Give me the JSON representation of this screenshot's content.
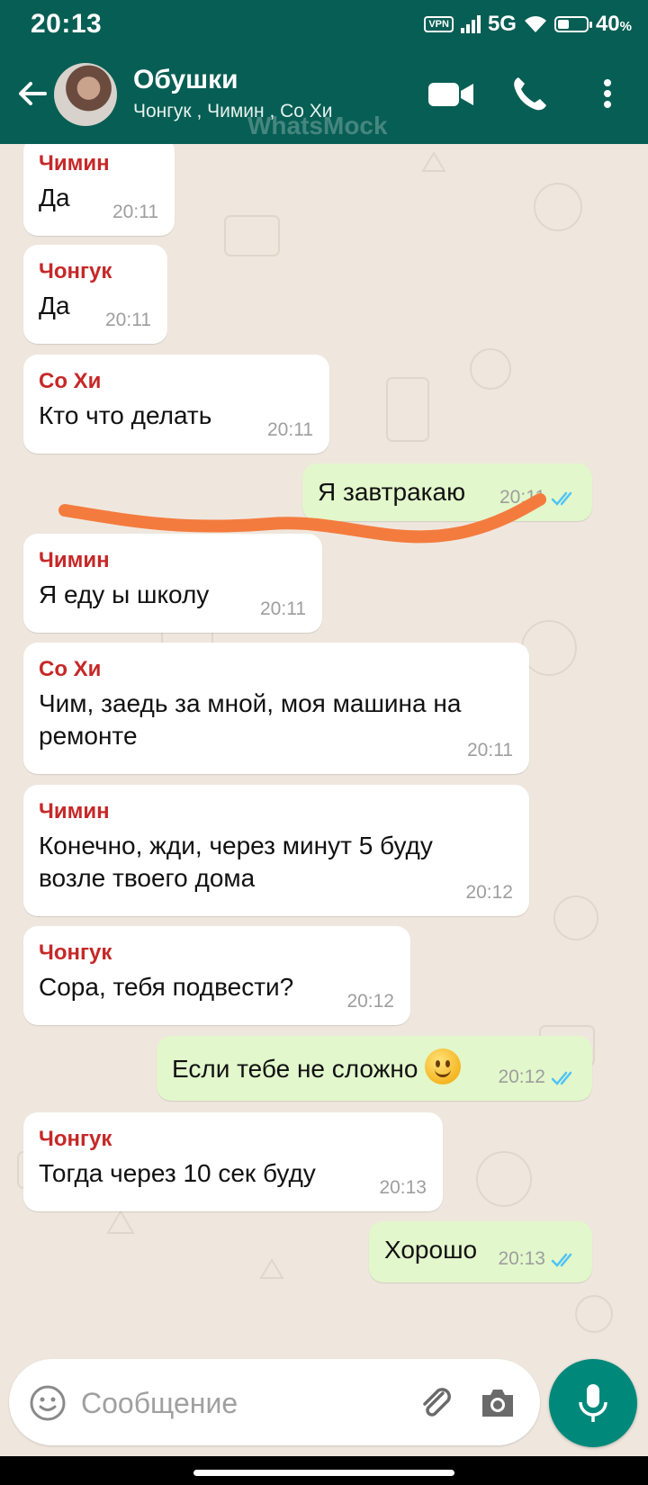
{
  "status_bar": {
    "time": "20:13",
    "vpn": "VPN",
    "network": "5G",
    "battery": "40",
    "battery_level": 0.4
  },
  "header": {
    "title": "Обушки",
    "members": "Чонгук , Чимин , Со Хи",
    "watermark": "WhatsMock"
  },
  "messages": [
    {
      "direction": "in",
      "sender": "Чимин",
      "lines": [
        "Да"
      ],
      "time": "20:11"
    },
    {
      "direction": "in",
      "sender": "Чонгук",
      "lines": [
        "Да"
      ],
      "time": "20:11"
    },
    {
      "direction": "in",
      "sender": "Со Хи",
      "lines": [
        "Кто что делать"
      ],
      "time": "20:11"
    },
    {
      "direction": "out",
      "lines": [
        "Я завтракаю"
      ],
      "time": "20:11"
    },
    {
      "direction": "in",
      "sender": "Чимин",
      "lines": [
        "Я еду ы школу"
      ],
      "time": "20:11"
    },
    {
      "direction": "in",
      "sender": "Со Хи",
      "lines": [
        "Чим, заедь за мной, моя машина на",
        "ремонте"
      ],
      "time": "20:11"
    },
    {
      "direction": "in",
      "sender": "Чимин",
      "lines": [
        "Конечно, жди, через минут 5 буду",
        "возле твоего дома"
      ],
      "time": "20:12"
    },
    {
      "direction": "in",
      "sender": "Чонгук",
      "lines": [
        "Сора, тебя подвести?"
      ],
      "time": "20:12"
    },
    {
      "direction": "out",
      "lines": [
        "Если тебе не сложно"
      ],
      "emoji": "slightly-smiling-face",
      "time": "20:12"
    },
    {
      "direction": "in",
      "sender": "Чонгук",
      "lines": [
        "Тогда через 10 сек буду"
      ],
      "time": "20:13"
    },
    {
      "direction": "out",
      "lines": [
        "Хорошо"
      ],
      "time": "20:13"
    }
  ],
  "composer": {
    "placeholder": "Сообщение"
  },
  "colors": {
    "header": "#075e54",
    "incoming": "#ffffff",
    "outgoing": "#e2f7cb",
    "sender_name": "#c62828",
    "read_ticks": "#4fc3f7",
    "mic_button": "#00897b",
    "annotation_stroke": "#f47b3e"
  }
}
